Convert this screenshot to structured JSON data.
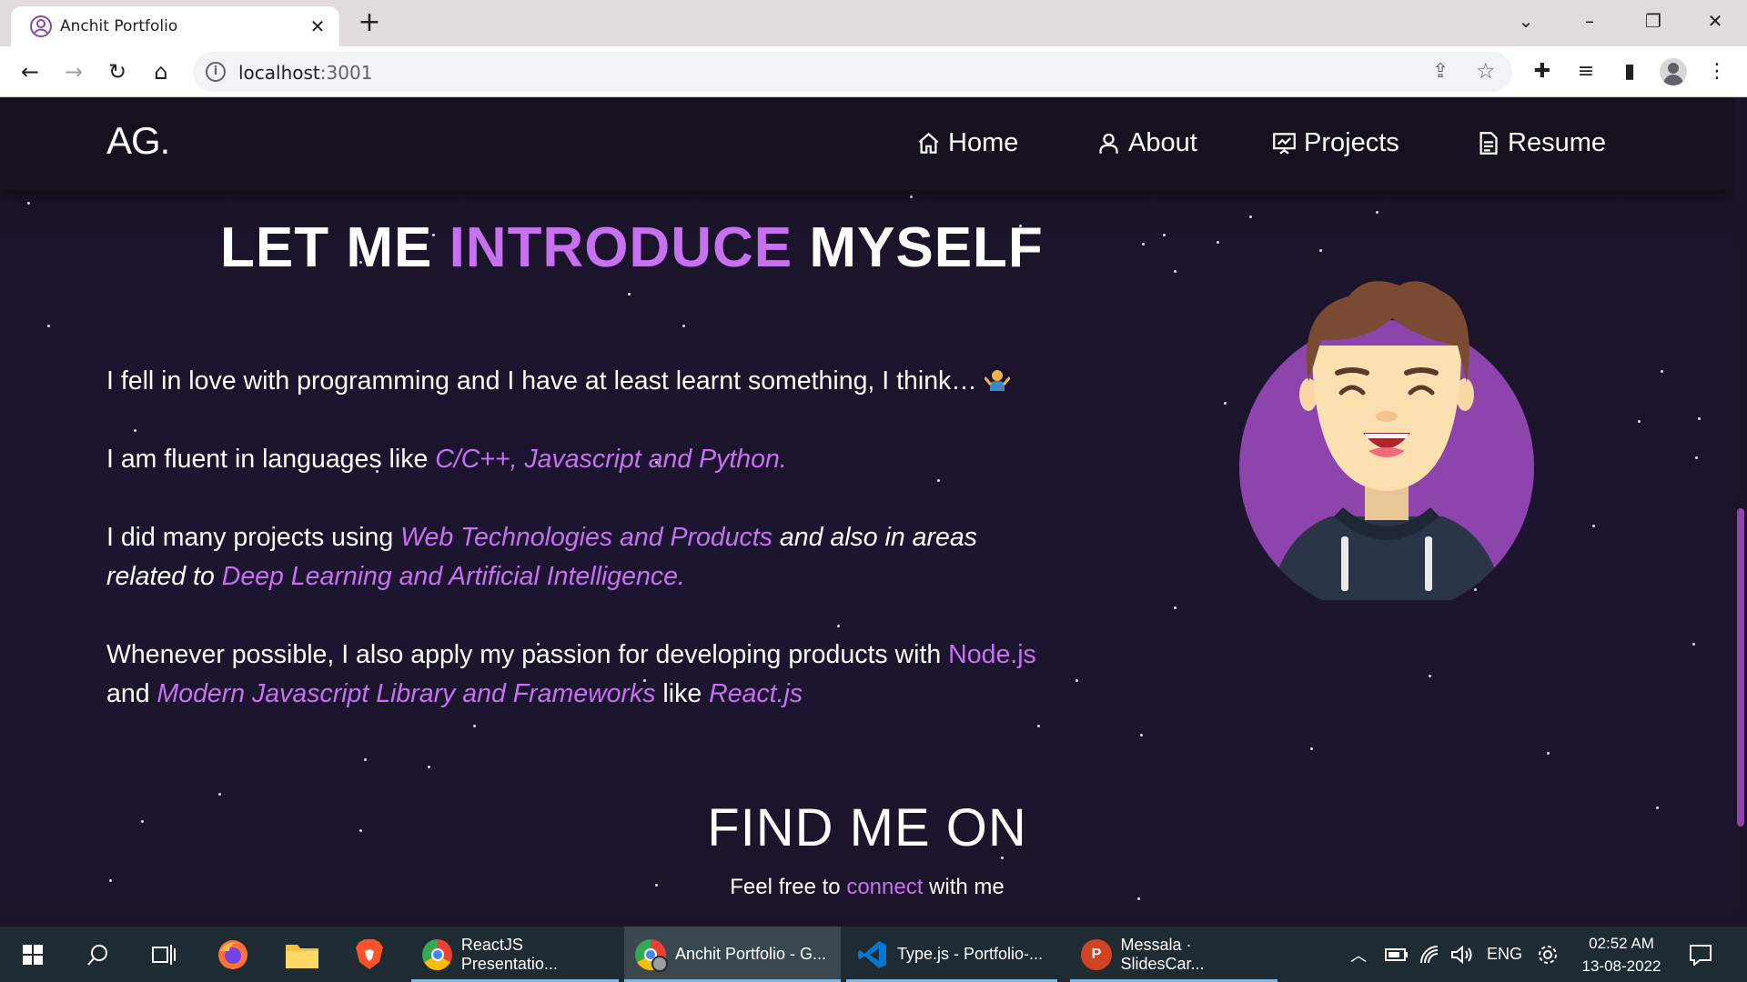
{
  "browser": {
    "tab_title": "Anchit Portfolio",
    "tab_close": "✕",
    "new_tab": "+",
    "url_host": "localhost",
    "url_port": ":3001"
  },
  "site": {
    "logo": "AG.",
    "nav": [
      {
        "label": "Home",
        "icon": "home-icon"
      },
      {
        "label": "About",
        "icon": "user-icon"
      },
      {
        "label": "Projects",
        "icon": "presentation-icon"
      },
      {
        "label": "Resume",
        "icon": "document-icon"
      }
    ]
  },
  "intro": {
    "heading_pre": "LET ME ",
    "heading_accent": "INTRODUCE",
    "heading_post": " MYSELF",
    "p1": "I fell in love with programming and I have at least learnt something, I think…",
    "p2_pre": "I am fluent in languages like ",
    "p2_accent": "C/C++, Javascript and Python.",
    "p3_pre": "I did many projects using  ",
    "p3_accent1": "Web Technologies and Products",
    "p3_mid": " and also in areas",
    "p3_line2_pre": "related to ",
    "p3_accent2": "Deep Learning and Artificial Intelligence.",
    "p4_pre": "Whenever possible, I also apply my passion for developing products with ",
    "p4_accent1": "Node.js",
    "p4_line2_pre": "and ",
    "p4_accent2": "Modern Javascript Library and Frameworks",
    "p4_mid": "  like ",
    "p4_accent3": "React.js"
  },
  "find": {
    "heading": "FIND ME ON",
    "sub_pre": "Feel free to ",
    "sub_accent": "connect",
    "sub_post": " with me"
  },
  "taskbar": {
    "apps": [
      {
        "label": "ReactJS Presentatio...",
        "icon": "chrome-icon"
      },
      {
        "label": "Anchit Portfolio - G...",
        "icon": "chrome-profile-icon"
      },
      {
        "label": "Type.js - Portfolio-...",
        "icon": "vscode-icon"
      },
      {
        "label": "Messala · SlidesCar...",
        "icon": "powerpoint-icon"
      }
    ],
    "lang": "ENG",
    "time": "02:52 AM",
    "date": "13-08-2022"
  },
  "colors": {
    "accent": "#c770f0",
    "background": "#1b1428",
    "navbar": "#16111f",
    "avatar_circle": "#8e44ad"
  }
}
